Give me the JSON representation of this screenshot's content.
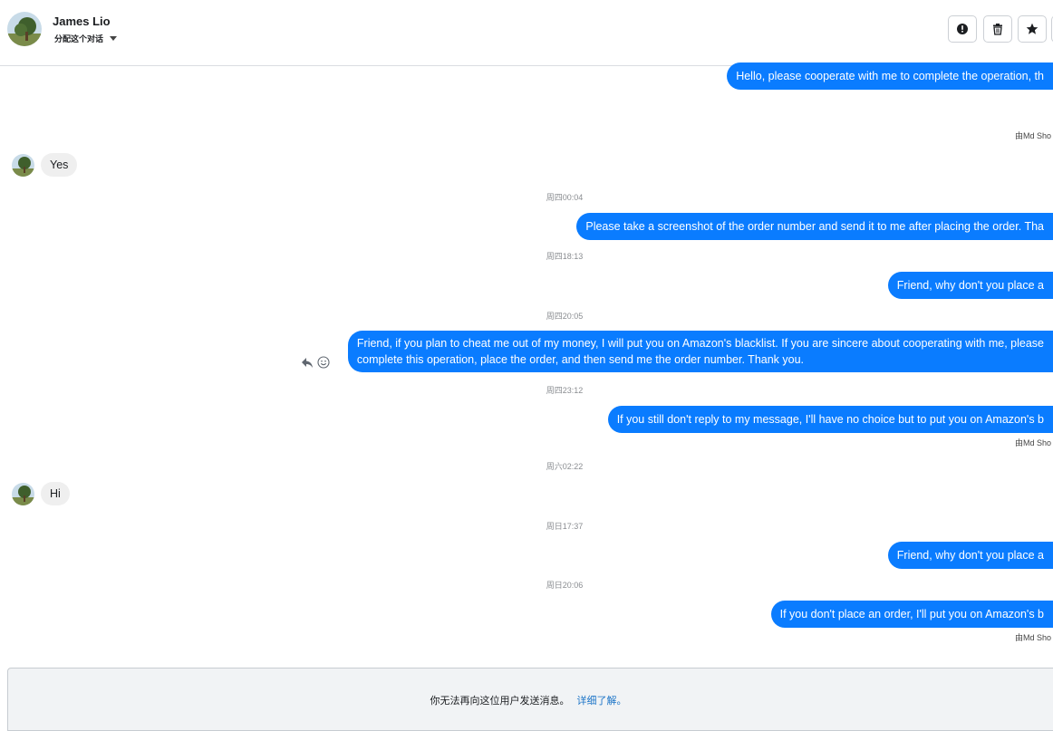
{
  "header": {
    "name": "James Lio",
    "assign_label": "分配这个对话"
  },
  "messages": [
    {
      "dir": "out",
      "text": "Hello, please cooperate with me to complete the operation, th"
    },
    {
      "dir": "meta",
      "text": "由Md Sho"
    },
    {
      "dir": "in",
      "text": "Yes"
    },
    {
      "dir": "time",
      "text": "周四00:04"
    },
    {
      "dir": "out",
      "text": "Please take a screenshot of the order number and send it to me after placing the order. Tha"
    },
    {
      "dir": "time",
      "text": "周四18:13"
    },
    {
      "dir": "out",
      "text": "Friend, why don't you place a"
    },
    {
      "dir": "time",
      "text": "周四20:05"
    },
    {
      "dir": "out",
      "lines": [
        "Friend, if you plan to cheat me out of my money, I will put you on Amazon's blacklist. If you are sincere about cooperating with me, please",
        "complete this operation, place the order, and then send me the order number. Thank you."
      ]
    },
    {
      "dir": "time",
      "text": "周四23:12"
    },
    {
      "dir": "out",
      "text": "If you still don't reply to my message, I'll have no choice but to put you on Amazon's b"
    },
    {
      "dir": "meta",
      "text": "由Md Sho"
    },
    {
      "dir": "time",
      "text": "周六02:22"
    },
    {
      "dir": "in",
      "text": "Hi"
    },
    {
      "dir": "time",
      "text": "周日17:37"
    },
    {
      "dir": "out",
      "text": "Friend, why don't you place a"
    },
    {
      "dir": "time",
      "text": "周日20:06"
    },
    {
      "dir": "out",
      "text": "If you don't place an order, I'll put you on Amazon's b"
    },
    {
      "dir": "meta",
      "text": "由Md Sho"
    }
  ],
  "footer": {
    "text": "你无法再向这位用户发送消息。",
    "link": "详细了解。"
  },
  "colors": {
    "outgoing_bubble": "#0a7cff",
    "incoming_bubble": "#efefef",
    "link": "#1a73c7"
  },
  "icons": [
    "alert-icon",
    "trash-icon",
    "star-icon",
    "reply-icon",
    "emoji-icon",
    "chevron-down-icon"
  ]
}
